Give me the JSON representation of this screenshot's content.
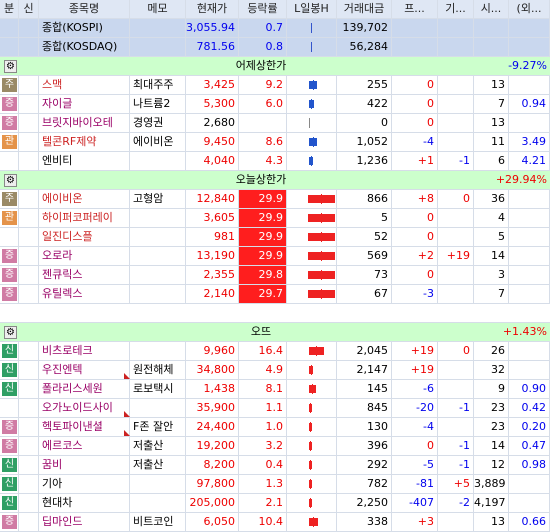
{
  "headers": {
    "cat": "분",
    "new": "신",
    "name": "종목명",
    "memo": "메모",
    "price": "현재가",
    "rate": "등락률",
    "candle": "L일봉H",
    "amount": "거래대금",
    "pro": "프...",
    "inst": "기...",
    "open": "시...",
    "foreign": "(외..."
  },
  "index_rows": [
    {
      "name": "종합(KOSPI)",
      "price": "3,055.94",
      "rate": "0.7",
      "amount": "139,702"
    },
    {
      "name": "종합(KOSDAQ)",
      "price": "781.56",
      "rate": "0.8",
      "amount": "56,284"
    }
  ],
  "groups": [
    {
      "title": "어제상한가",
      "rate": "-9.27%",
      "rows": [
        {
          "badge": "주",
          "name": "스맥",
          "memo": "최대주주",
          "price": "3,425",
          "rate": "9.2",
          "amount": "255",
          "pro": "0",
          "inst": "",
          "open": "13",
          "foreign": ""
        },
        {
          "badge": "증",
          "name": "자이글",
          "memo": "나트륨2",
          "price": "5,300",
          "rate": "6.0",
          "amount": "422",
          "pro": "0",
          "inst": "",
          "open": "7",
          "foreign": "0.94"
        },
        {
          "badge": "증",
          "name": "브릿지바이오테",
          "memo": "경영권",
          "price": "2,680",
          "rate": "",
          "amount": "0",
          "pro": "0",
          "inst": "",
          "open": "13",
          "foreign": ""
        },
        {
          "badge": "관",
          "name": "텔콘RF제약",
          "memo": "에이비온",
          "price": "9,450",
          "rate": "8.6",
          "amount": "1,052",
          "pro": "-4",
          "inst": "",
          "open": "11",
          "foreign": "3.49"
        },
        {
          "badge": "",
          "name": "엔비티",
          "memo": "",
          "price": "4,040",
          "rate": "4.3",
          "amount": "1,236",
          "pro": "+1",
          "inst": "-1",
          "open": "6",
          "foreign": "4.21"
        }
      ]
    },
    {
      "title": "오늘상한가",
      "rate": "+29.94%",
      "rows": [
        {
          "badge": "주",
          "name": "에이비온",
          "memo": "고형암",
          "price": "12,840",
          "rate": "29.9",
          "amount": "866",
          "pro": "+8",
          "inst": "0",
          "open": "36",
          "foreign": ""
        },
        {
          "badge": "관",
          "name": "하이퍼코퍼레이",
          "memo": "",
          "price": "3,605",
          "rate": "29.9",
          "amount": "5",
          "pro": "0",
          "inst": "",
          "open": "4",
          "foreign": ""
        },
        {
          "badge": "",
          "name": "일진디스플",
          "memo": "",
          "price": "981",
          "rate": "29.9",
          "amount": "52",
          "pro": "0",
          "inst": "",
          "open": "5",
          "foreign": ""
        },
        {
          "badge": "증",
          "name": "오로라",
          "memo": "",
          "price": "13,190",
          "rate": "29.9",
          "amount": "569",
          "pro": "+2",
          "inst": "+19",
          "open": "14",
          "foreign": ""
        },
        {
          "badge": "증",
          "name": "젠큐릭스",
          "memo": "",
          "price": "2,355",
          "rate": "29.8",
          "amount": "73",
          "pro": "0",
          "inst": "",
          "open": "3",
          "foreign": ""
        },
        {
          "badge": "증",
          "name": "유틸렉스",
          "memo": "",
          "price": "2,140",
          "rate": "29.7",
          "amount": "67",
          "pro": "-3",
          "inst": "",
          "open": "7",
          "foreign": ""
        }
      ]
    },
    {
      "title": "오뜨",
      "rate": "+1.43%",
      "rows": [
        {
          "badge": "신",
          "name": "비츠로테크",
          "memo": "",
          "price": "9,960",
          "rate": "16.4",
          "amount": "2,045",
          "pro": "+19",
          "inst": "0",
          "open": "26",
          "foreign": ""
        },
        {
          "badge": "신",
          "name": "우진엔텍",
          "memo": "원전해체",
          "price": "34,800",
          "rate": "4.9",
          "amount": "2,147",
          "pro": "+19",
          "inst": "",
          "open": "32",
          "foreign": ""
        },
        {
          "badge": "신",
          "name": "폴라리스세원",
          "memo": "로보택시",
          "price": "1,438",
          "rate": "8.1",
          "amount": "145",
          "pro": "-6",
          "inst": "",
          "open": "9",
          "foreign": "0.90"
        },
        {
          "badge": "",
          "name": "오가노이드사이",
          "memo": "",
          "price": "35,900",
          "rate": "1.1",
          "amount": "845",
          "pro": "-20",
          "inst": "-1",
          "open": "23",
          "foreign": "0.42"
        },
        {
          "badge": "증",
          "name": "헥토파이낸셜",
          "memo": "F존 잘안",
          "price": "24,400",
          "rate": "1.0",
          "amount": "130",
          "pro": "-4",
          "inst": "",
          "open": "23",
          "foreign": "0.20"
        },
        {
          "badge": "증",
          "name": "에르코스",
          "memo": "저출산",
          "price": "19,200",
          "rate": "3.2",
          "amount": "396",
          "pro": "0",
          "inst": "-1",
          "open": "14",
          "foreign": "0.47"
        },
        {
          "badge": "신",
          "name": "꿈비",
          "memo": "저출산",
          "price": "8,200",
          "rate": "0.4",
          "amount": "292",
          "pro": "-5",
          "inst": "-1",
          "open": "12",
          "foreign": "0.98"
        },
        {
          "badge": "신",
          "name": "기아",
          "memo": "",
          "price": "97,800",
          "rate": "1.3",
          "amount": "782",
          "pro": "-81",
          "inst": "+5",
          "open": "3,889",
          "foreign": ""
        },
        {
          "badge": "신",
          "name": "현대차",
          "memo": "",
          "price": "205,000",
          "rate": "2.1",
          "amount": "2,250",
          "pro": "-407",
          "inst": "-2",
          "open": "4,197",
          "foreign": ""
        },
        {
          "badge": "증",
          "name": "딥마인드",
          "memo": "비트코인",
          "price": "6,050",
          "rate": "10.4",
          "amount": "338",
          "pro": "+3",
          "inst": "",
          "open": "13",
          "foreign": "0.66"
        }
      ]
    }
  ]
}
